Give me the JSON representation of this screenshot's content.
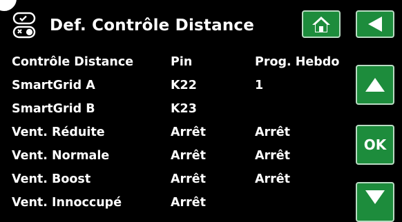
{
  "header": {
    "title": "Def. Contrôle Distance"
  },
  "nav": {
    "home_icon": "home-icon",
    "back_icon": "back-arrow-icon",
    "up_icon": "up-arrow-icon",
    "ok_label": "OK",
    "down_icon": "down-arrow-icon",
    "accent_color": "#1d8c3c"
  },
  "table": {
    "headers": [
      "Contrôle Distance",
      "Pin",
      "Prog. Hebdo"
    ],
    "rows": [
      {
        "name": "SmartGrid A",
        "pin": "K22",
        "prog": "1"
      },
      {
        "name": "SmartGrid B",
        "pin": "K23",
        "prog": ""
      },
      {
        "name": "Vent. Réduite",
        "pin": "Arrêt",
        "prog": "Arrêt"
      },
      {
        "name": "Vent. Normale",
        "pin": "Arrêt",
        "prog": "Arrêt"
      },
      {
        "name": "Vent. Boost",
        "pin": "Arrêt",
        "prog": "Arrêt"
      },
      {
        "name": "Vent. Innoccupé",
        "pin": "Arrêt",
        "prog": ""
      }
    ]
  }
}
